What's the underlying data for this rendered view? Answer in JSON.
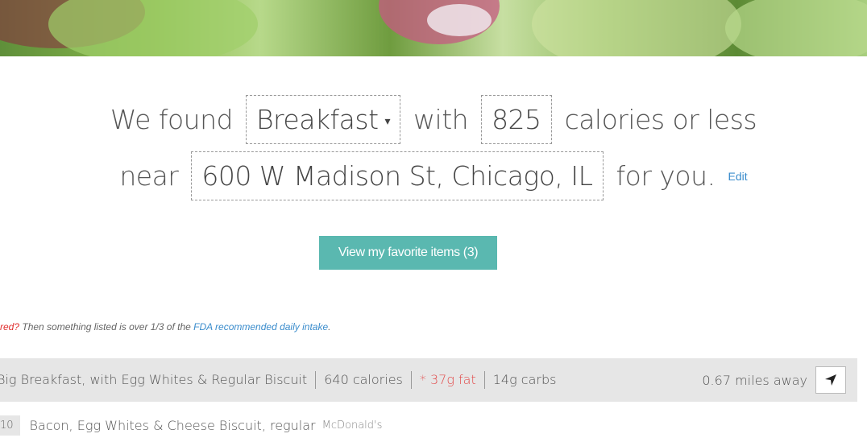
{
  "hero": {
    "colors": [
      "#5f8f3a",
      "#8dbb4e",
      "#b7d98a",
      "#c55a82"
    ]
  },
  "search": {
    "prefix": "We found",
    "meal": "Breakfast",
    "with": "with",
    "calories": "825",
    "suffix": "calories or less",
    "near": "near",
    "location": "600 W Madison St, Chicago, IL",
    "for_you": "for you.",
    "edit_label": "Edit"
  },
  "favorites_button": "View my favorite items (3)",
  "note": {
    "red_word": "red?",
    "text": " Then something listed is over 1/3 of the ",
    "link": "FDA recommended daily intake",
    "end": "."
  },
  "results": [
    {
      "name": "Big Breakfast, with Egg Whites & Regular Biscuit",
      "calories": "640 calories",
      "fat": "* 37g fat",
      "carbs": "14g carbs",
      "distance": "0.67 miles away",
      "nav_icon": "location-arrow-icon"
    },
    {
      "badge": "10",
      "name": "Bacon, Egg Whites & Cheese Biscuit, regular",
      "restaurant": "McDonald's"
    }
  ],
  "colors": {
    "accent": "#5ab8b0",
    "link": "#3a8ccc",
    "warning": "#e24a4a"
  }
}
